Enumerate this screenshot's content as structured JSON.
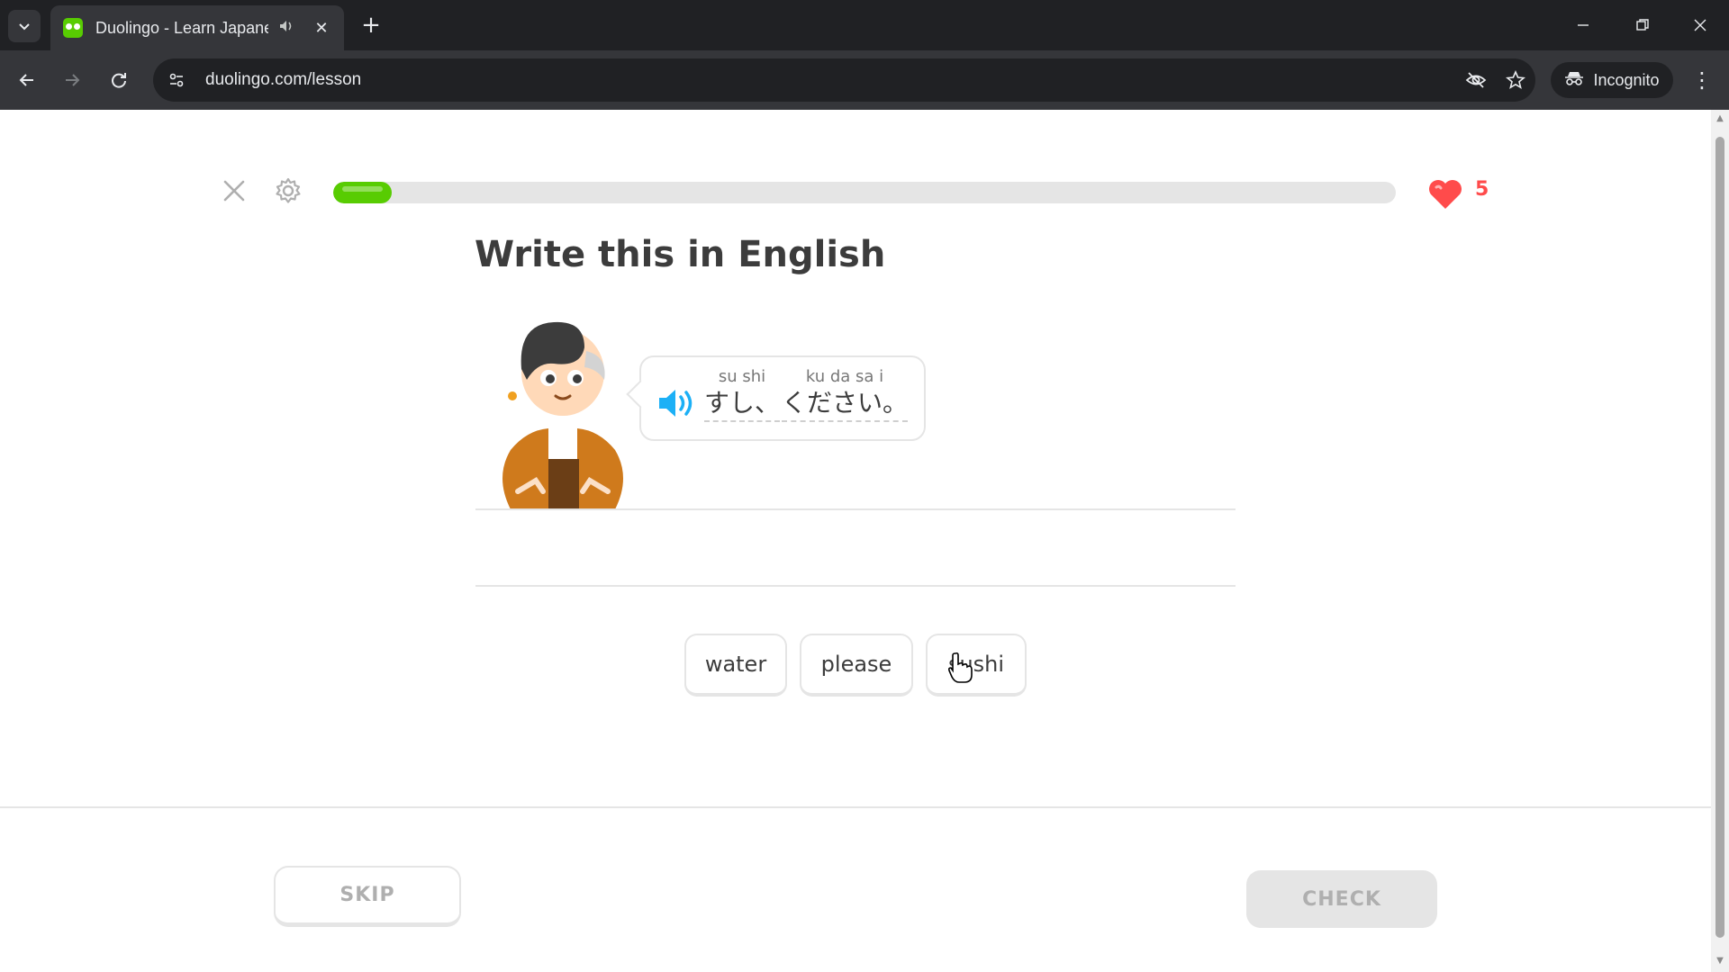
{
  "browser": {
    "tab_title": "Duolingo - Learn Japanese",
    "url": "duolingo.com/lesson",
    "profile_label": "Incognito"
  },
  "lesson": {
    "progress_percent": 5.5,
    "hearts": "5",
    "prompt": "Write this in English",
    "sentence": [
      {
        "romaji": "su shi",
        "kana": "すし、"
      },
      {
        "romaji": "ku da sa   i",
        "kana": "ください。"
      }
    ],
    "word_bank": [
      "water",
      "please",
      "sushi"
    ],
    "skip_label": "SKIP",
    "check_label": "CHECK"
  },
  "colors": {
    "accent_green": "#58cc02",
    "heart_red": "#ff4b4b",
    "speaker_blue": "#1cb0f6",
    "text_dark": "#3c3c3c",
    "border_gray": "#e5e5e5"
  },
  "icons": [
    "tab-search-icon",
    "audio-icon",
    "close-icon",
    "plus-icon",
    "back-icon",
    "forward-icon",
    "reload-icon",
    "site-info-icon",
    "eye-off-icon",
    "star-icon",
    "incognito-icon",
    "more-vert-icon",
    "gear-icon",
    "heart-icon",
    "speaker-icon",
    "hand-cursor-icon"
  ]
}
